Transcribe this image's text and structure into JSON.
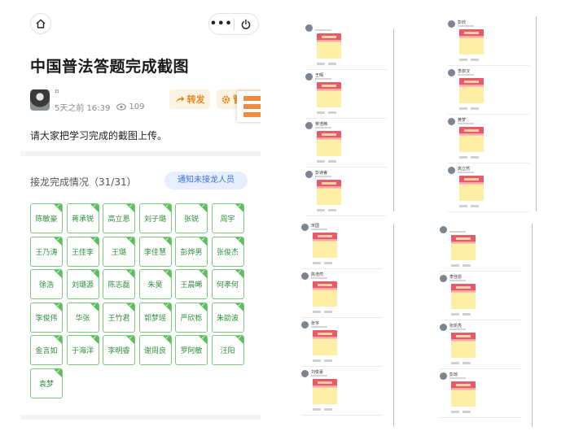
{
  "header": {
    "home_icon": "home-icon",
    "more_label": "•••",
    "power_icon": "power-icon"
  },
  "post": {
    "title": "中国普法答题完成截图",
    "author": "¤",
    "time": "5天之前 16:39",
    "views": "109",
    "forward_label": "转发",
    "manage_label": "管理",
    "description": "请大家把学习完成的截图上传。"
  },
  "status": {
    "label": "接龙完成情况（31/31）",
    "notify_label": "通知未接龙人员"
  },
  "names": [
    "陈敏豪",
    "蒋承锐",
    "高立恩",
    "刘子璐",
    "张锐",
    "周宇",
    "王乃涛",
    "王佳李",
    "王璐",
    "李佳慧",
    "彭烨男",
    "张俊杰",
    "徐浩",
    "刘璐源",
    "陈志磊",
    "朱昊",
    "王晨晞",
    "何孝何",
    "李俊伟",
    "华张",
    "王竹君",
    "郭梦瑶",
    "严欣栎",
    "朱劭波",
    "金言如",
    "于海洋",
    "李明睿",
    "谢周良",
    "罗阿敏",
    "汪阳",
    "袁梦"
  ],
  "collage_names": [
    "",
    "王晴",
    "蒋浩楠",
    "彭诗睿",
    "彭欣",
    "李叔汉",
    "黄梦",
    "高立然",
    "宋国",
    "陈浩然",
    "张宇",
    "刘俊豪",
    "",
    "李佳恩",
    "张凯亮",
    "彭琼"
  ],
  "colors": {
    "accent_orange": "#e68a1e",
    "accent_blue": "#3b6fd8",
    "check_green": "#5bbf5b"
  }
}
